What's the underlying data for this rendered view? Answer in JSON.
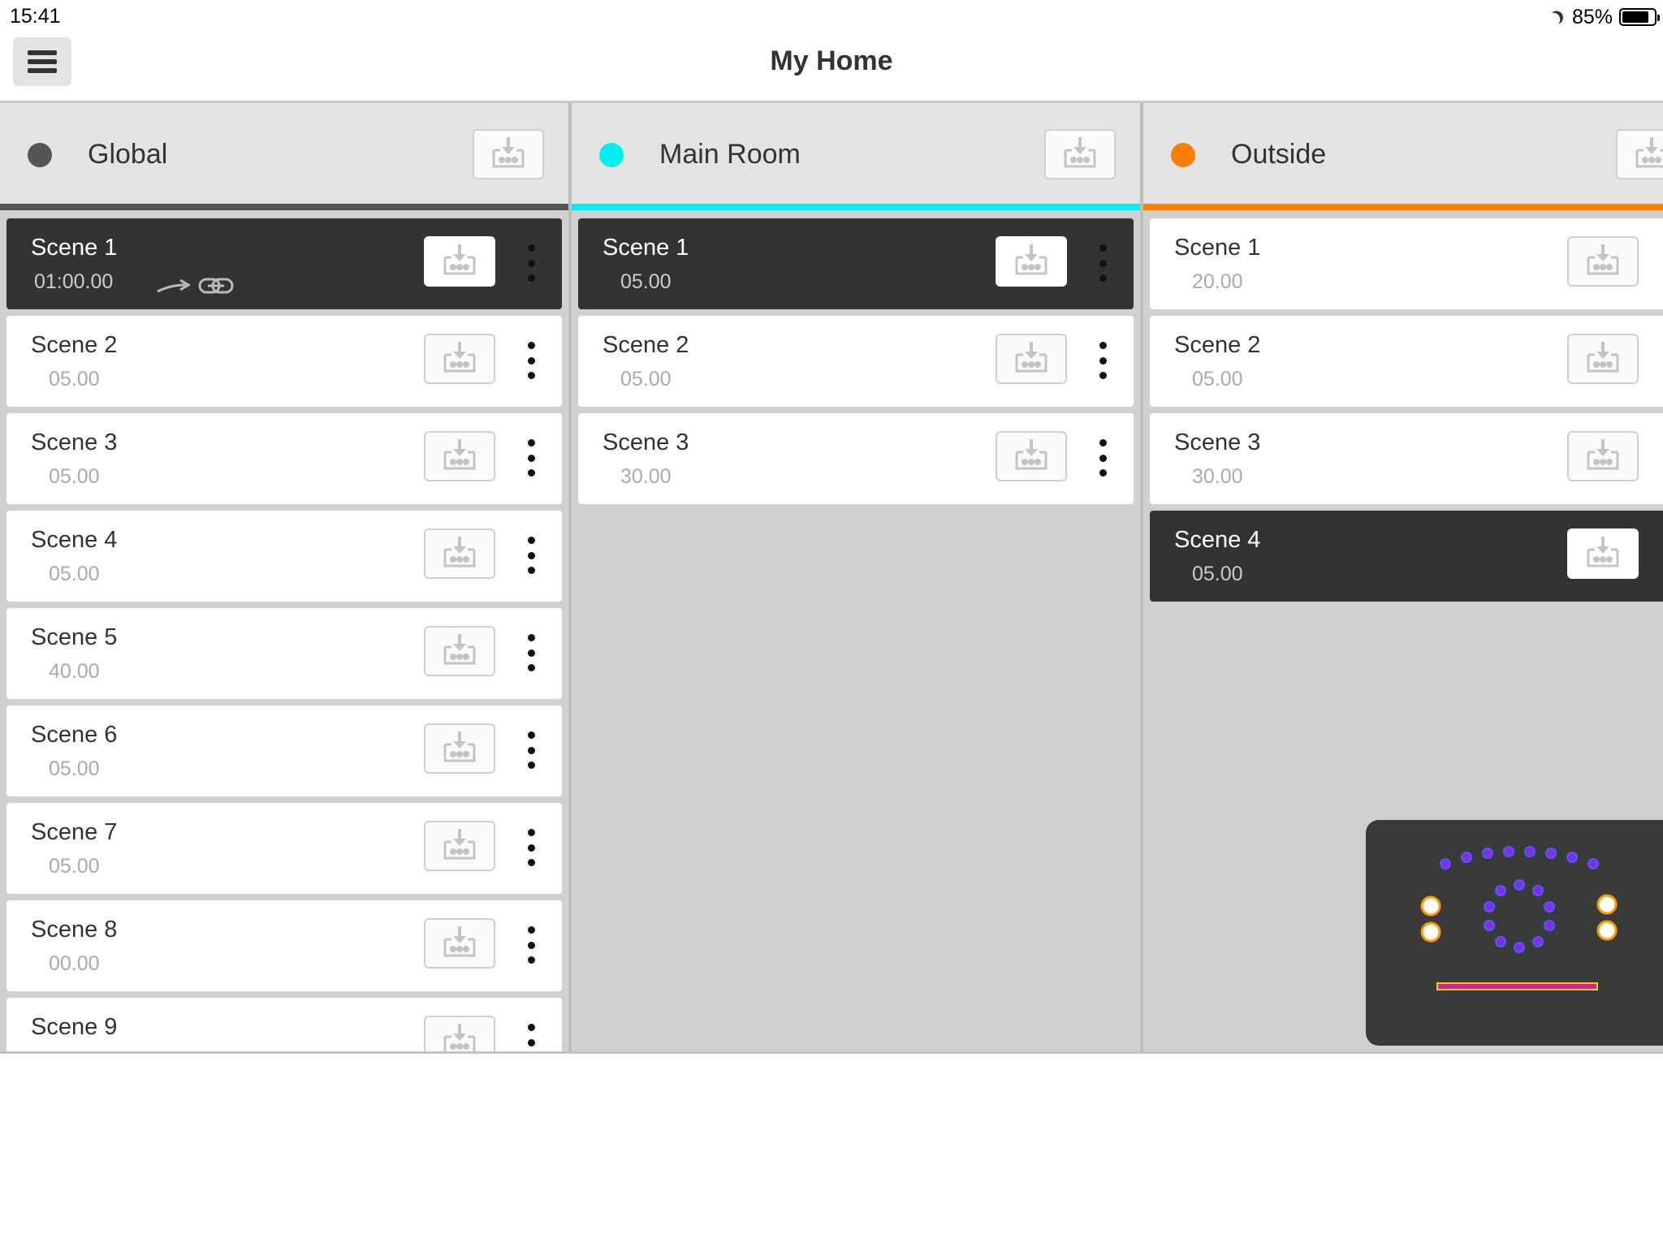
{
  "status_bar": {
    "time": "15:41",
    "battery": "85%",
    "battery_level": 0.85
  },
  "header": {
    "title": "My Home",
    "menu_icon": "hamburger-icon"
  },
  "colors": {
    "global": "#555555",
    "main_room": "#00f0f0",
    "outside": "#ff7f00",
    "active_scene": "#333333"
  },
  "columns": [
    {
      "name": "Global",
      "color": "#555555",
      "scenes": [
        {
          "name": "Scene 1",
          "time": "01:00.00",
          "active": true,
          "linked": true
        },
        {
          "name": "Scene 2",
          "time": "05.00"
        },
        {
          "name": "Scene 3",
          "time": "05.00"
        },
        {
          "name": "Scene 4",
          "time": "05.00"
        },
        {
          "name": "Scene 5",
          "time": "40.00"
        },
        {
          "name": "Scene 6",
          "time": "05.00"
        },
        {
          "name": "Scene 7",
          "time": "05.00"
        },
        {
          "name": "Scene 8",
          "time": "00.00"
        },
        {
          "name": "Scene 9",
          "time": ""
        }
      ]
    },
    {
      "name": "Main Room",
      "color": "#00f0f0",
      "scenes": [
        {
          "name": "Scene 1",
          "time": "05.00",
          "active": true
        },
        {
          "name": "Scene 2",
          "time": "05.00"
        },
        {
          "name": "Scene 3",
          "time": "30.00"
        }
      ]
    },
    {
      "name": "Outside",
      "color": "#ff7f00",
      "scenes": [
        {
          "name": "Scene 1",
          "time": "20.00"
        },
        {
          "name": "Scene 2",
          "time": "05.00"
        },
        {
          "name": "Scene 3",
          "time": "30.00"
        },
        {
          "name": "Scene 4",
          "time": "05.00",
          "active": true
        }
      ]
    }
  ]
}
